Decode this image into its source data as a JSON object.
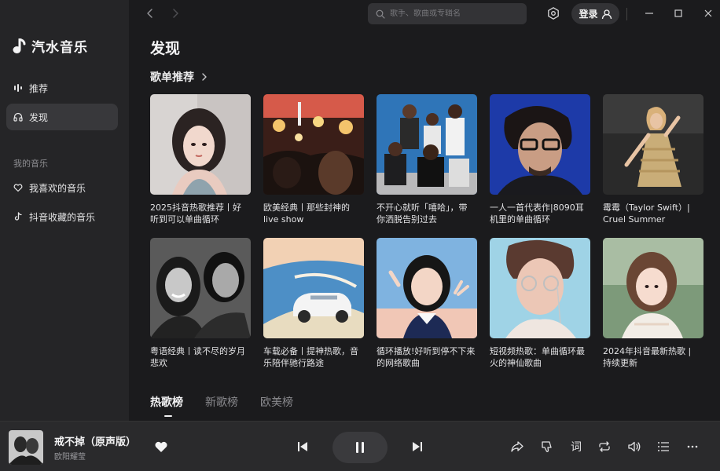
{
  "app": {
    "name": "汽水音乐"
  },
  "sidebar": {
    "items": [
      {
        "label": "推荐",
        "icon": "bars-icon"
      },
      {
        "label": "发现",
        "icon": "headphones-icon",
        "active": true
      }
    ],
    "my_music_title": "我的音乐",
    "my_music": [
      {
        "label": "我喜欢的音乐",
        "icon": "heart-icon"
      },
      {
        "label": "抖音收藏的音乐",
        "icon": "tiktok-icon"
      }
    ]
  },
  "topbar": {
    "search_placeholder": "歌手、歌曲或专辑名",
    "login_label": "登录"
  },
  "page": {
    "title": "发现",
    "section_title": "歌单推荐",
    "playlists": [
      {
        "title": "2025抖音热歌推荐丨好听到可以单曲循环"
      },
      {
        "title": "欧美经典丨那些封神的live show"
      },
      {
        "title": "不开心就听「嘻哈」，带你洒脱告别过去"
      },
      {
        "title": "一人一首代表作|8090耳机里的单曲循环"
      },
      {
        "title": "霉霉（Taylor Swift）| Cruel Summer"
      },
      {
        "title": "粤语经典丨读不尽的岁月悲欢"
      },
      {
        "title": "车载必备丨提神热歌，音乐陪伴驰行路途"
      },
      {
        "title": "循环播放!好听到停不下来的网络歌曲"
      },
      {
        "title": "短视频热歌：单曲循环最火的神仙歌曲"
      },
      {
        "title": "2024年抖音最新热歌 | 持续更新"
      }
    ],
    "tabs": [
      {
        "label": "热歌榜",
        "active": true
      },
      {
        "label": "新歌榜"
      },
      {
        "label": "欧美榜"
      }
    ]
  },
  "player": {
    "song_title": "戒不掉（原声版）",
    "artist": "欧阳耀莹",
    "liked": true,
    "state": "playing",
    "lyrics_label": "词"
  },
  "colors": {
    "background": "#1b1b1d",
    "sidebar": "#252527",
    "player": "#2a2a2c",
    "active_nav": "#38383b"
  }
}
